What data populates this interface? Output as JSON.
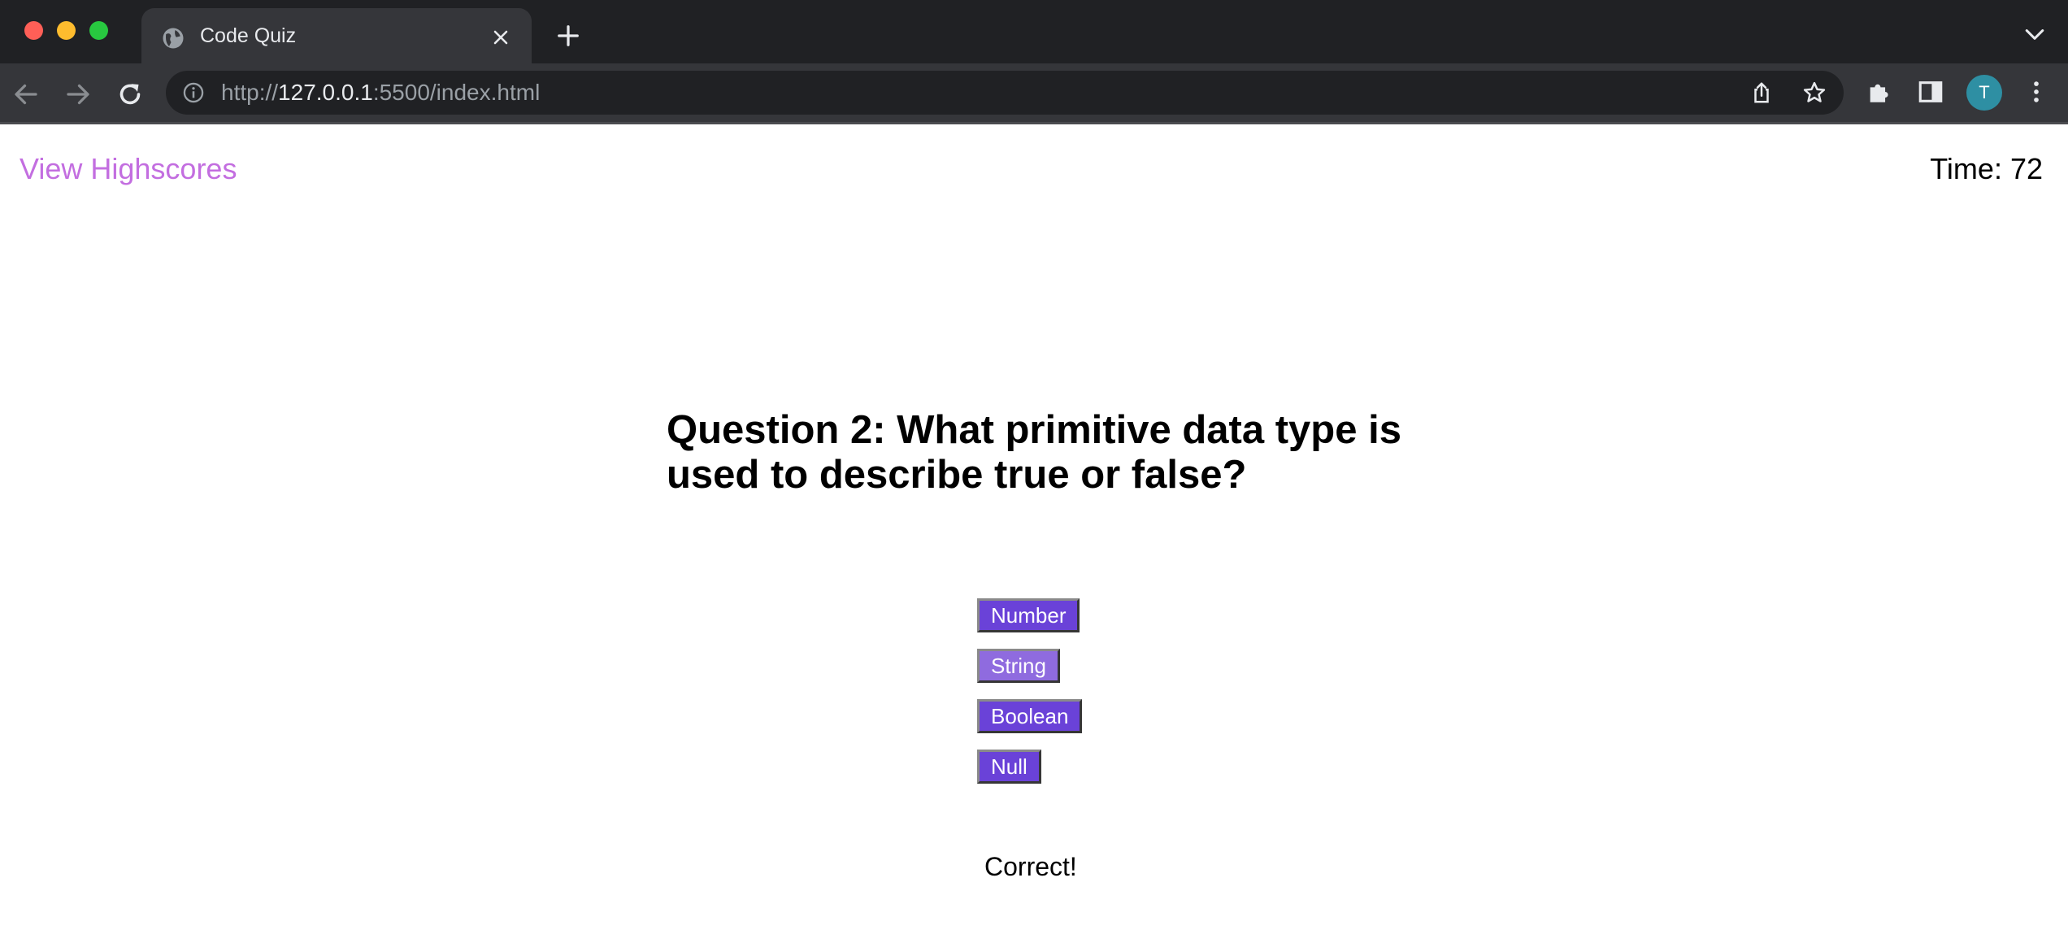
{
  "browser": {
    "tab_title": "Code Quiz",
    "url_scheme": "http://",
    "url_host": "127.0.0.1",
    "url_rest": ":5500/index.html",
    "avatar_initial": "T"
  },
  "header": {
    "highscores_label": "View Highscores",
    "timer_text": "Time: 72"
  },
  "quiz": {
    "question": "Question 2: What primitive data type is used to describe true or false?",
    "answers": [
      "Number",
      "String",
      "Boolean",
      "Null"
    ],
    "feedback": "Correct!"
  },
  "colors": {
    "link": "#c36ee0",
    "button": "#6a42d8",
    "button_hover": "#8f6bdf"
  }
}
